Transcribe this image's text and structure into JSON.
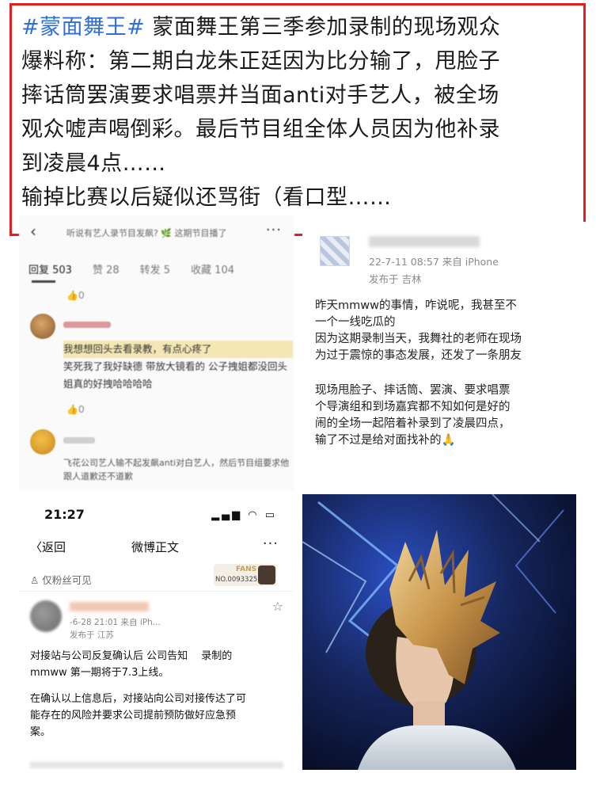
{
  "caption": {
    "hashtag": "#蒙面舞王#",
    "lines": [
      " 蒙面舞王第三季参加录制的现场观众",
      "爆料称：第二期白龙朱正廷因为比分输了，甩脸子",
      "摔话筒罢演要求唱票并当面anti对手艺人，被全场",
      "观众嘘声喝倒彩。最后节目组全体人员因为他补录",
      "到凌晨4点……",
      "输掉比赛以后疑似还骂街（看口型……"
    ]
  },
  "panel_a": {
    "header_title": "听说有艺人录节目发飙? 🌿 这期节目播了",
    "tabs": [
      "回复 503",
      "赞 28",
      "转发 5",
      "收藏 104"
    ],
    "comment1_text": "笑死我了我好缺德 带放大镜看的 公子拽姐都没回头 姐真的好拽哈哈哈哈",
    "comment1_highlight": "我想想回头去看录教，有点心疼了",
    "comment2_text": "飞花公司艺人输不起发飙anti对白艺人，然后节目组要求他跟人道歉还不道歉",
    "like1": "0",
    "like2": "0"
  },
  "panel_b": {
    "meta_line": "22-7-11 08:57  来自 iPhone",
    "location_line": "发布于 吉林",
    "body_lines": [
      "昨天mmww的事情，咋说呢，我甚至不",
      "一个一线吃瓜的",
      "因为这期录制当天，我舞社的老师在现场",
      "为过于震惊的事态发展，还发了一条朋友",
      "",
      "现场甩脸子、摔话筒、罢演、要求唱票",
      "个导演组和到场嘉宾都不知如何是好的",
      "闹的全场一起陪着补录到了凌晨四点，",
      "输了不过是给对面找补的🙏"
    ]
  },
  "panel_c": {
    "time": "21:27",
    "back_label": "〈返回",
    "title": "微博正文",
    "fans_only": "仅粉丝可见",
    "fans_badge_label": "FANS",
    "fans_badge_no": "NO.0093325",
    "post_meta": "-6-28 21:01  来自  iPh...",
    "post_location": "发布于 江苏",
    "body_lines": [
      "对接站与公司反复确认后 公司告知　 录制的",
      "mmww 第一期将于7.3上线。",
      "",
      "在确认以上信息后，对接站向公司对接传达了可",
      "能存在的风险并要求公司提前预防做好应急预",
      "案。"
    ]
  }
}
